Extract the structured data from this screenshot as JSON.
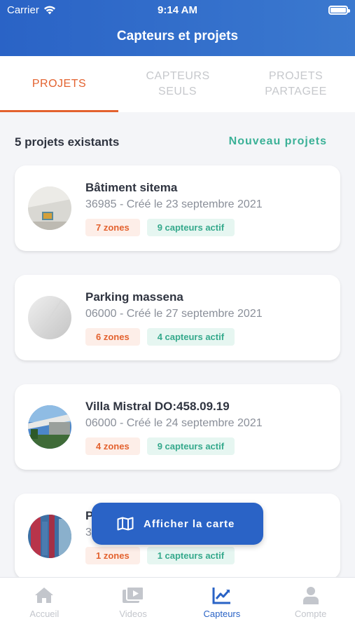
{
  "status_bar": {
    "carrier": "Carrier",
    "time": "9:14 AM"
  },
  "header": {
    "title": "Capteurs et projets"
  },
  "tabs": [
    {
      "label": "PROJETS",
      "active": true
    },
    {
      "label": "CAPTEURS SEULS",
      "active": false
    },
    {
      "label": "PROJETS PARTAGEE",
      "active": false
    }
  ],
  "summary": {
    "count_text": "5 projets existants",
    "new_project_label": "Nouveau projets"
  },
  "projects": [
    {
      "name": "Bâtiment sitema",
      "subtitle": "36985 - Créé le 23 septembre 2021",
      "zones": "7 zones",
      "sensors": "9 capteurs actif"
    },
    {
      "name": "Parking massena",
      "subtitle": "06000 - Créé le 27 septembre 2021",
      "zones": "6 zones",
      "sensors": "4 capteurs actif"
    },
    {
      "name": "Villa Mistral DO:458.09.19",
      "subtitle": "06000 - Créé le 24 septembre 2021",
      "zones": "4 zones",
      "sensors": "9 capteurs actif"
    },
    {
      "name": "P",
      "subtitle": "3",
      "zones": "1 zones",
      "sensors": "1 capteurs actif"
    }
  ],
  "map_button": {
    "label": "Afficher la carte",
    "icon": "map-icon"
  },
  "tab_bar": [
    {
      "label": "Accueil",
      "icon": "home-icon",
      "active": false
    },
    {
      "label": "Videos",
      "icon": "videos-icon",
      "active": false
    },
    {
      "label": "Capteurs",
      "icon": "chart-icon",
      "active": true
    },
    {
      "label": "Compte",
      "icon": "user-icon",
      "active": false
    }
  ],
  "colors": {
    "primary": "#2a63c6",
    "accent": "#e3622f",
    "success": "#3bb197"
  }
}
